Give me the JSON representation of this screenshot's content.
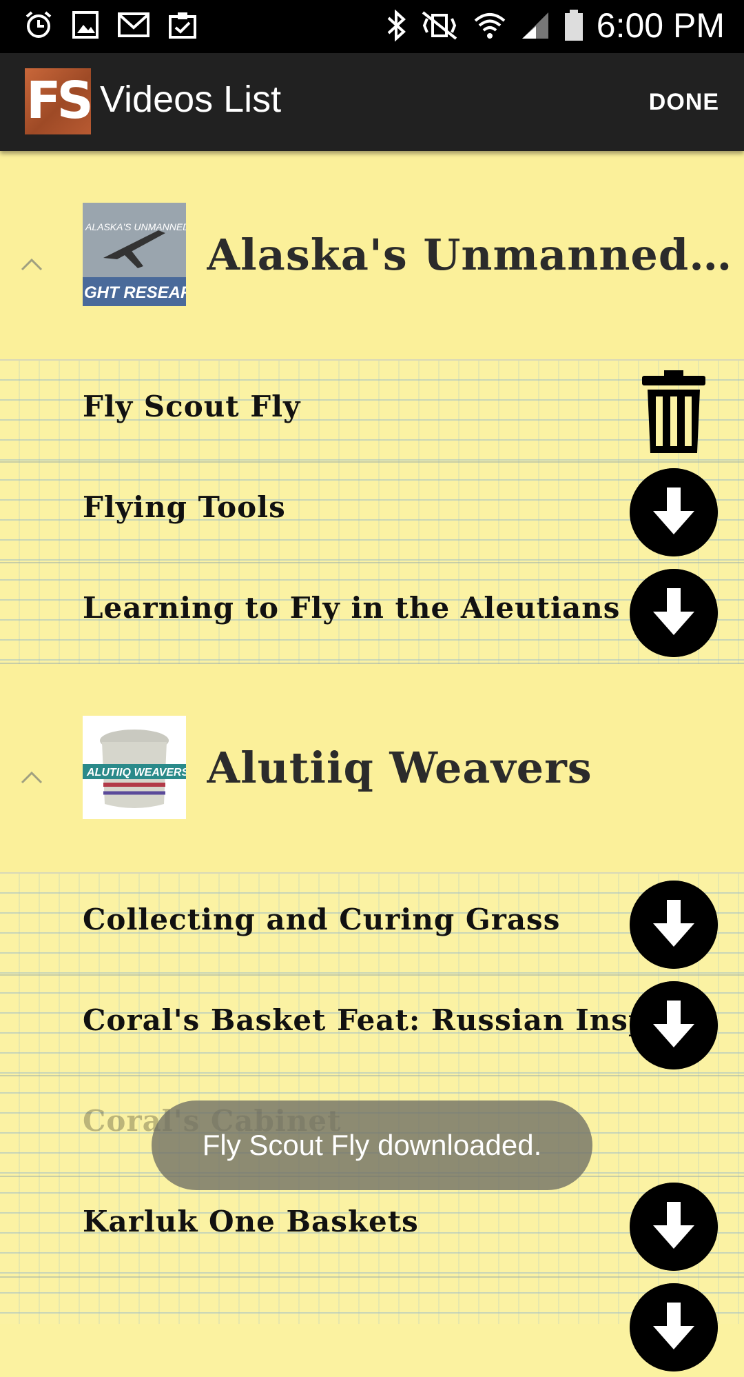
{
  "status_bar": {
    "time": "6:00 PM",
    "left_icons": [
      "alarm-icon",
      "image-icon",
      "gmail-icon",
      "clipboard-check-icon"
    ],
    "right_icons": [
      "bluetooth-icon",
      "vibrate-off-icon",
      "wifi-icon",
      "signal-icon",
      "battery-icon"
    ]
  },
  "action_bar": {
    "logo_text": "FS",
    "title": "Videos List",
    "done_label": "DONE"
  },
  "groups": [
    {
      "title": "Alaska's Unmanned Aircr...",
      "expanded": true,
      "thumbnail_text": [
        "ALASKA'S UNMANNED",
        "GHT RESEAR"
      ],
      "items": [
        {
          "label": "Fly Scout Fly",
          "action": "trash-icon"
        },
        {
          "label": "Flying Tools",
          "action": "download-icon"
        },
        {
          "label": "Learning to Fly in the Aleutians",
          "action": "download-icon"
        }
      ]
    },
    {
      "title": "Alutiiq Weavers",
      "expanded": true,
      "thumbnail_text": [
        "ALUTIIQ WEAVERS"
      ],
      "items": [
        {
          "label": "Collecting and Curing Grass",
          "action": "download-icon"
        },
        {
          "label": "Coral's Basket Feat: Russian Inspired",
          "action": "download-icon"
        },
        {
          "label": "Coral's Cabinet",
          "action": "none"
        },
        {
          "label": "Karluk One Baskets",
          "action": "download-icon"
        }
      ]
    }
  ],
  "toast": {
    "message": "Fly Scout Fly downloaded."
  },
  "colors": {
    "header_bg": "#212121",
    "paper_bg": "#fbf2a3",
    "group_bg": "#fbf09a"
  }
}
